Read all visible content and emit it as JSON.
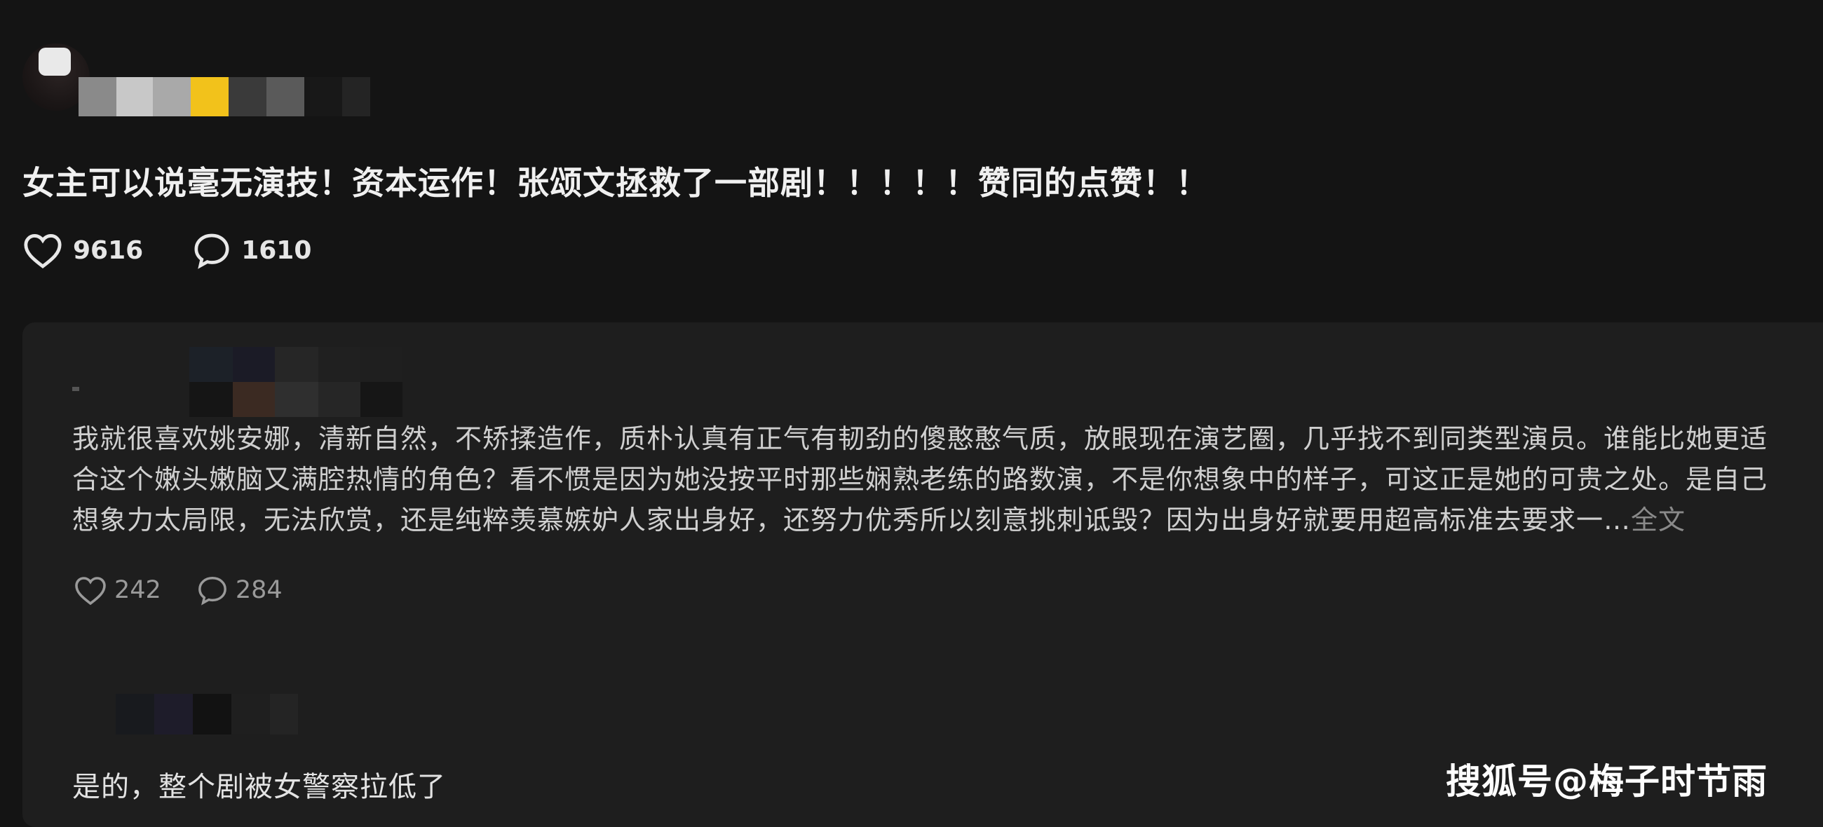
{
  "post": {
    "text": "女主可以说毫无演技！资本运作！张颂文拯救了一部剧！！！！！赞同的点赞！！",
    "likes": "9616",
    "comments": "1610"
  },
  "reply": {
    "text": "我就很喜欢姚安娜，清新自然，不矫揉造作，质朴认真有正气有韧劲的傻憨憨气质，放眼现在演艺圈，几乎找不到同类型演员。谁能比她更适合这个嫩头嫩脑又满腔热情的角色？看不惯是因为她没按平时那些娴熟老练的路数演，不是你想象中的样子，可这正是她的可贵之处。是自己想象力太局限，无法欣赏，还是纯粹羡慕嫉妒人家出身好，还努力优秀所以刻意挑刺诋毁？因为出身好就要用超高标准去要求一…",
    "more": "全文",
    "likes": "242",
    "comments": "284"
  },
  "sub_reply": {
    "text": "是的，整个剧被女警察拉低了"
  },
  "watermark": "搜狐号@梅子时节雨",
  "icons": {
    "like": "heart-icon",
    "comment": "comment-bubble-icon"
  },
  "colors": {
    "background": "#141414",
    "card": "#1e1e1e",
    "highlight_pixel": "#f2c21b"
  }
}
